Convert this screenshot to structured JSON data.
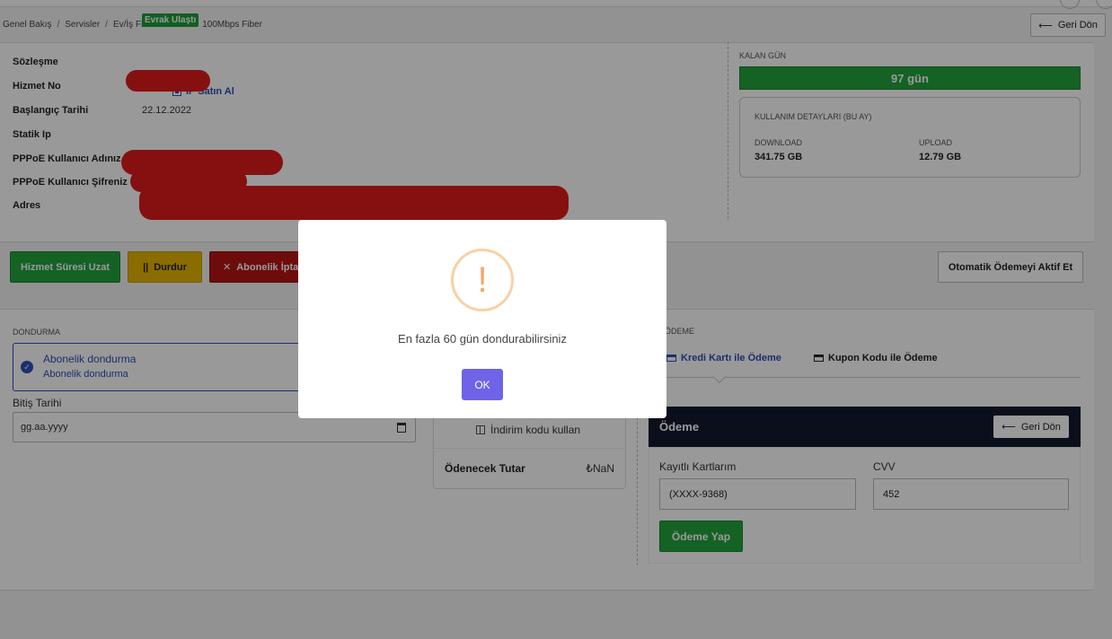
{
  "breadcrumb": [
    "Genel Bakış",
    "Servisler",
    "Ev/İş Fiber İnternet",
    "100Mbps Fiber"
  ],
  "breadcrumb_sep": "/",
  "back_button": "Geri Dön",
  "info": {
    "rows": [
      "Sözleşme",
      "Hizmet No",
      "Başlangıç Tarihi",
      "Statik Ip",
      "PPPoE Kullanıcı Adınız",
      "PPPoE Kullanıcı Şifreniz",
      "Adres"
    ],
    "contract_badge": "Evrak Ulaştı",
    "start_date": "22.12.2022",
    "ip_link": "IP Satın Al"
  },
  "remaining": {
    "label": "KALAN GÜN",
    "value": "97 gün"
  },
  "usage": {
    "title": "KULLANIM DETAYLARI (BU AY)",
    "download_label": "DOWNLOAD",
    "download_value": "341.75 GB",
    "upload_label": "UPLOAD",
    "upload_value": "12.79 GB"
  },
  "actions": {
    "extend": "Hizmet Süresi Uzat",
    "pause_icon": "||",
    "pause": "Durdur",
    "cancel": "Abonelik İptal",
    "auto_pay": "Otomatik Ödemeyi Aktif Et"
  },
  "freeze": {
    "section_label": "DONDURMA",
    "option_title": "Abonelik dondurma",
    "option_sub": "Abonelik dondurma",
    "end_date_label": "Bitiş Tarihi",
    "end_date_placeholder": "gg.aa.yyyy"
  },
  "summary": {
    "coupon_link": "İndirim kodu kullan",
    "total_label": "Ödenecek Tutar",
    "total_value": "₺NaN"
  },
  "payment": {
    "section_label": "ÖDEME",
    "tab_card": "Kredi Kartı ile Ödeme",
    "tab_coupon": "Kupon Kodu ile Ödeme",
    "header": "Ödeme",
    "back": "Geri Dön",
    "saved_cards_label": "Kayıtlı Kartlarım",
    "saved_card_value": "(XXXX-9368)",
    "cvv_label": "CVV",
    "cvv_value": "452",
    "pay_button": "Ödeme Yap"
  },
  "modal": {
    "icon": "!",
    "message": "En fazla 60 gün dondurabilirsiniz",
    "ok": "OK"
  }
}
